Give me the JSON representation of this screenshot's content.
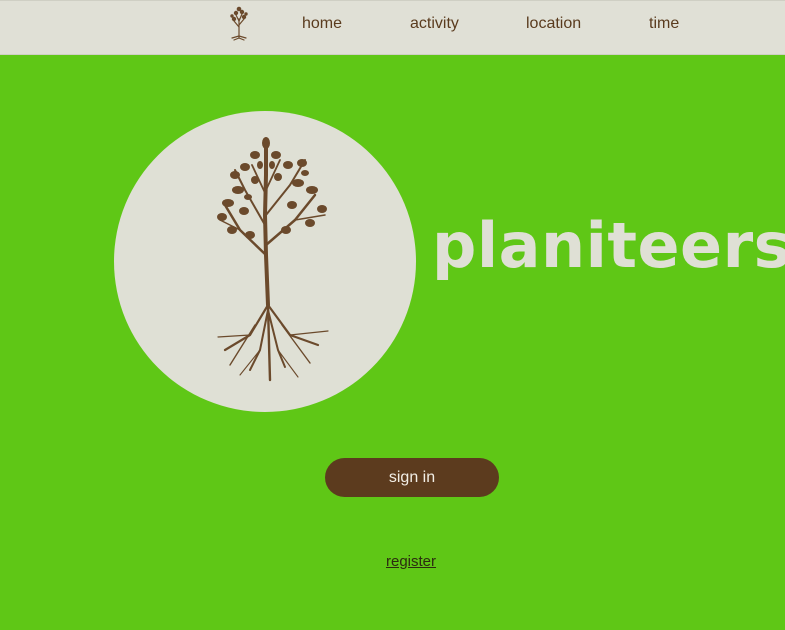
{
  "nav": {
    "logo_icon": "tree-icon",
    "links": [
      "home",
      "activity",
      "location",
      "time"
    ]
  },
  "hero": {
    "logo_icon": "tree-logo-icon",
    "brand": "planiteers"
  },
  "actions": {
    "sign_in": "sign in",
    "register": "register"
  },
  "colors": {
    "background": "#5fc716",
    "navbar": "#e0e0d6",
    "brown": "#5c3b1e",
    "cream": "#dfe0d5"
  }
}
